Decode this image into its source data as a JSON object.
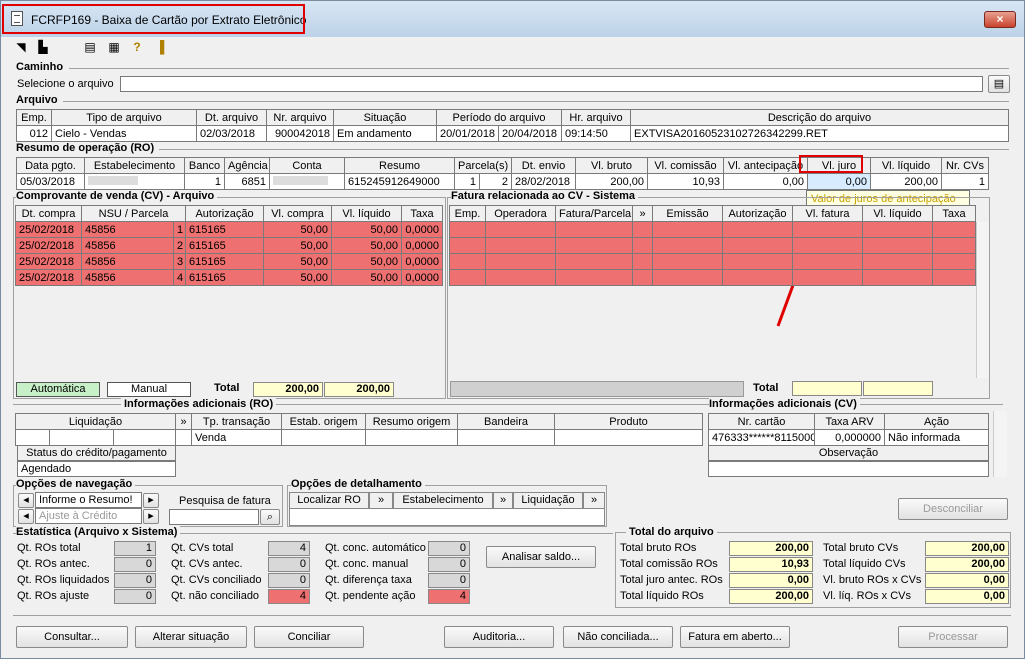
{
  "window": {
    "title": "FCRFP169 - Baixa de Cartão por Extrato Eletrônico",
    "close": "×"
  },
  "caminho": {
    "section": "Caminho",
    "label": "Selecione o arquivo",
    "value": ""
  },
  "arquivo": {
    "section": "Arquivo",
    "headers": [
      "Emp.",
      "Tipo de arquivo",
      "Dt. arquivo",
      "Nr. arquivo",
      "Situação",
      "Período do arquivo",
      "",
      "Hr. arquivo",
      "Descrição do arquivo"
    ],
    "row": [
      "012",
      "Cielo - Vendas",
      "02/03/2018",
      "900042018",
      "Em andamento",
      "20/01/2018",
      "20/04/2018",
      "09:14:50",
      "EXTVISA20160523102726342299.RET"
    ]
  },
  "ro": {
    "section": "Resumo de operação (RO)",
    "headers": [
      "Data pgto.",
      "Estabelecimento",
      "Banco",
      "Agência",
      "Conta",
      "Resumo",
      "Parcela(s)",
      "Dt. envio",
      "Vl. bruto",
      "Vl. comissão",
      "Vl. antecipação",
      "Vl. juro",
      "Vl. líquido",
      "Nr. CVs"
    ],
    "row": [
      "05/03/2018",
      "",
      "1",
      "6851",
      "",
      "615245912649000",
      "1",
      "2",
      "28/02/2018",
      "200,00",
      "10,93",
      "0,00",
      "0,00",
      "200,00",
      "1"
    ]
  },
  "tooltip": "Valor de juros de antecipação",
  "cv": {
    "section": "Comprovante de venda (CV) - Arquivo",
    "headers": [
      "Dt. compra",
      "NSU / Parcela",
      "",
      "Autorização",
      "Vl. compra",
      "Vl. líquido",
      "Taxa"
    ],
    "rows": [
      [
        "25/02/2018",
        "45856",
        "1",
        "615165",
        "50,00",
        "50,00",
        "0,0000"
      ],
      [
        "25/02/2018",
        "45856",
        "2",
        "615165",
        "50,00",
        "50,00",
        "0,0000"
      ],
      [
        "25/02/2018",
        "45856",
        "3",
        "615165",
        "50,00",
        "50,00",
        "0,0000"
      ],
      [
        "25/02/2018",
        "45856",
        "4",
        "615165",
        "50,00",
        "50,00",
        "0,0000"
      ]
    ],
    "auto": "Automática",
    "manual": "Manual",
    "total_label": "Total",
    "total_compra": "200,00",
    "total_liquido": "200,00"
  },
  "fatura": {
    "section": "Fatura relacionada ao CV - Sistema",
    "headers": [
      "Emp.",
      "Operadora",
      "Fatura/Parcela",
      "»",
      "Emissão",
      "Autorização",
      "Vl. fatura",
      "Vl. líquido",
      "Taxa"
    ],
    "total_label": "Total"
  },
  "info_ro": {
    "section": "Informações adicionais (RO)",
    "headers": [
      "Liquidação",
      "»",
      "Tp. transação",
      "Estab. origem",
      "Resumo origem",
      "Bandeira",
      "Produto"
    ],
    "tp_transacao": "Venda",
    "status_label": "Status do crédito/pagamento",
    "status_value": "Agendado"
  },
  "info_cv": {
    "section": "Informações adicionais (CV)",
    "headers": [
      "Nr. cartão",
      "Taxa ARV",
      "Ação"
    ],
    "row": [
      "476333******8115000",
      "0,000000",
      "Não informada"
    ],
    "obs_label": "Observação"
  },
  "nav": {
    "section": "Opções de navegação",
    "sel1": "Informe o Resumo!",
    "sel2": "Ajuste à Crédito",
    "pesquisa": "Pesquisa de fatura"
  },
  "detalhe": {
    "section": "Opções de detalhamento",
    "localizar": "Localizar RO",
    "estab": "Estabelecimento",
    "liquidacao": "Liquidação"
  },
  "desconciliar": "Desconciliar",
  "estat": {
    "section": "Estatística (Arquivo x Sistema)",
    "c1": [
      [
        "Qt. ROs total",
        "1"
      ],
      [
        "Qt. ROs antec.",
        "0"
      ],
      [
        "Qt. ROs liquidados",
        "0"
      ],
      [
        "Qt. ROs ajuste",
        "0"
      ]
    ],
    "c2": [
      [
        "Qt. CVs total",
        "4"
      ],
      [
        "Qt. CVs antec.",
        "0"
      ],
      [
        "Qt. CVs conciliado",
        "0"
      ],
      [
        "Qt. não conciliado",
        "4"
      ]
    ],
    "c3": [
      [
        "Qt. conc. automático",
        "0"
      ],
      [
        "Qt. conc. manual",
        "0"
      ],
      [
        "Qt. diferença taxa",
        "0"
      ],
      [
        "Qt. pendente ação",
        "4"
      ]
    ],
    "analisar": "Analisar saldo..."
  },
  "total": {
    "section": "Total do arquivo",
    "c1": [
      [
        "Total bruto ROs",
        "200,00"
      ],
      [
        "Total comissão ROs",
        "10,93"
      ],
      [
        "Total juro antec. ROs",
        "0,00"
      ],
      [
        "Total líquido ROs",
        "200,00"
      ]
    ],
    "c2": [
      [
        "Total bruto CVs",
        "200,00"
      ],
      [
        "Total líquido CVs",
        "200,00"
      ],
      [
        "Vl. bruto ROs x CVs",
        "0,00"
      ],
      [
        "Vl. líq. ROs x CVs",
        "0,00"
      ]
    ]
  },
  "buttons": {
    "consultar": "Consultar...",
    "alterar": "Alterar situação",
    "conciliar": "Conciliar",
    "auditoria": "Auditoria...",
    "nao_conc": "Não conciliada...",
    "fatura_aberto": "Fatura em aberto...",
    "processar": "Processar"
  }
}
